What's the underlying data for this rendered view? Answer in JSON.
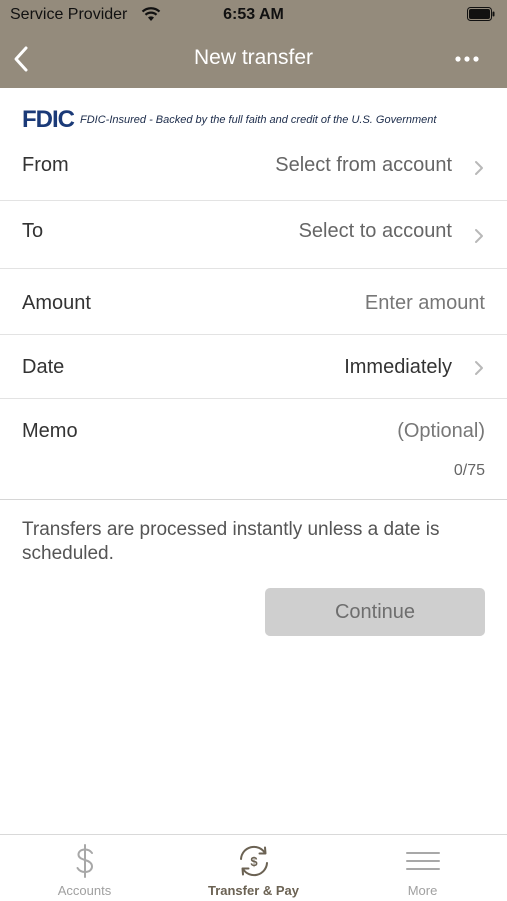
{
  "status_bar": {
    "carrier": "Service Provider",
    "time": "6:53 AM",
    "icons": [
      "wifi-icon",
      "battery-icon"
    ]
  },
  "nav": {
    "title": "New transfer",
    "back_icon": "chevron-left-icon",
    "more_icon": "more-dots-icon"
  },
  "fdic": {
    "logo": "FDIC",
    "tagline": "FDIC-Insured - Backed by the full faith and credit of the U.S. Government"
  },
  "form": {
    "from": {
      "label": "From",
      "value": "Select from account"
    },
    "to": {
      "label": "To",
      "value": "Select to account"
    },
    "amount": {
      "label": "Amount",
      "placeholder": "Enter amount"
    },
    "date": {
      "label": "Date",
      "value": "Immediately"
    },
    "memo": {
      "label": "Memo",
      "placeholder": "(Optional)",
      "counter": "0/75"
    }
  },
  "info_text": "Transfers are processed instantly unless a date is scheduled.",
  "continue_label": "Continue",
  "tabs": [
    {
      "label": "Accounts",
      "icon": "dollar-icon",
      "active": false
    },
    {
      "label": "Transfer & Pay",
      "icon": "transfer-pay-icon",
      "active": true
    },
    {
      "label": "More",
      "icon": "hamburger-menu-icon",
      "active": false
    }
  ],
  "colors": {
    "header_bg": "#948b7c",
    "fdic_blue": "#1b3a78",
    "button_disabled_bg": "#cfcfcf",
    "tab_active": "#6b6253",
    "tab_inactive": "#a0a0a0"
  }
}
